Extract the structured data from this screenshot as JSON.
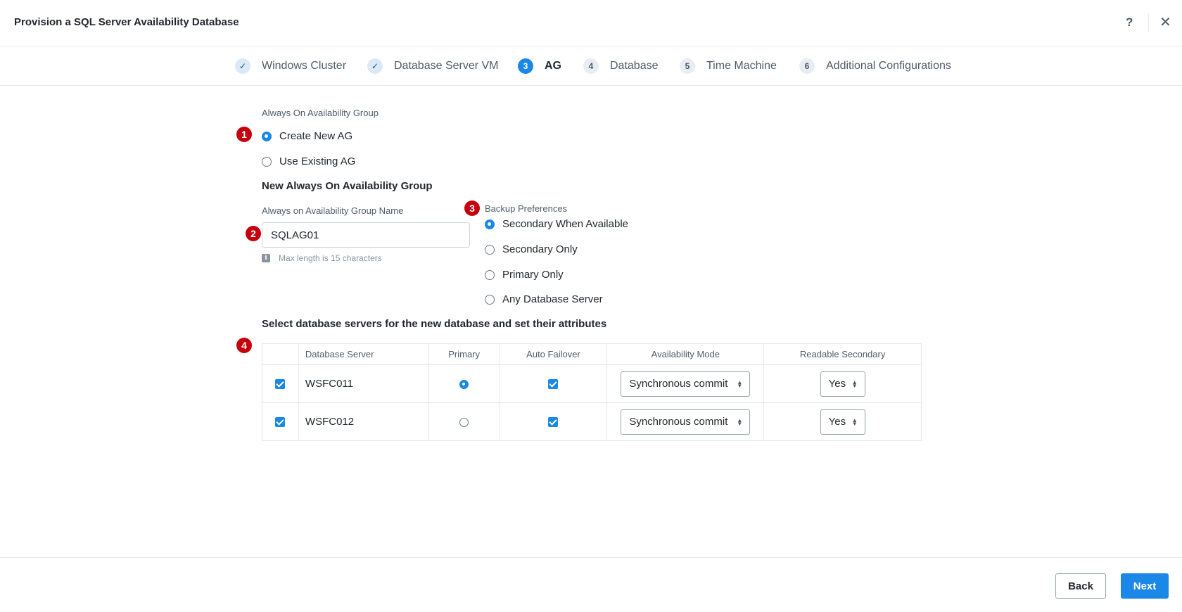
{
  "header": {
    "title": "Provision a SQL Server Availability Database",
    "help_label": "?",
    "close_label": "✕"
  },
  "stepper": {
    "steps": [
      {
        "marker": "✓",
        "label": "Windows Cluster",
        "state": "done"
      },
      {
        "marker": "✓",
        "label": "Database Server VM",
        "state": "done"
      },
      {
        "marker": "3",
        "label": "AG",
        "state": "active"
      },
      {
        "marker": "4",
        "label": "Database",
        "state": "pending"
      },
      {
        "marker": "5",
        "label": "Time Machine",
        "state": "pending"
      },
      {
        "marker": "6",
        "label": "Additional Configurations",
        "state": "pending"
      }
    ]
  },
  "badges": [
    "1",
    "2",
    "3",
    "4"
  ],
  "ag": {
    "section_label": "Always On Availability Group",
    "options": [
      {
        "label": "Create New AG",
        "selected": true
      },
      {
        "label": "Use Existing AG",
        "selected": false
      }
    ],
    "new_heading": "New Always On Availability Group",
    "name_label": "Always on Availability Group Name",
    "name_value": "SQLAG01",
    "name_hint": "Max length is 15 characters",
    "info_icon_glyph": "i"
  },
  "backup": {
    "label": "Backup Preferences",
    "options": [
      {
        "label": "Secondary When Available",
        "selected": true
      },
      {
        "label": "Secondary Only",
        "selected": false
      },
      {
        "label": "Primary Only",
        "selected": false
      },
      {
        "label": "Any Database Server",
        "selected": false
      }
    ]
  },
  "servers": {
    "heading": "Select database servers for the new database and set their attributes",
    "columns": [
      "",
      "Database Server",
      "Primary",
      "Auto Failover",
      "Availability Mode",
      "Readable Secondary"
    ],
    "rows": [
      {
        "selected": true,
        "name": "WSFC011",
        "primary": true,
        "auto_failover": true,
        "mode": "Synchronous commit",
        "readable": "Yes"
      },
      {
        "selected": true,
        "name": "WSFC012",
        "primary": false,
        "auto_failover": true,
        "mode": "Synchronous commit",
        "readable": "Yes"
      }
    ]
  },
  "footer": {
    "back_label": "Back",
    "next_label": "Next"
  },
  "colors": {
    "accent": "#1b87e6",
    "badge": "#c4000f"
  }
}
